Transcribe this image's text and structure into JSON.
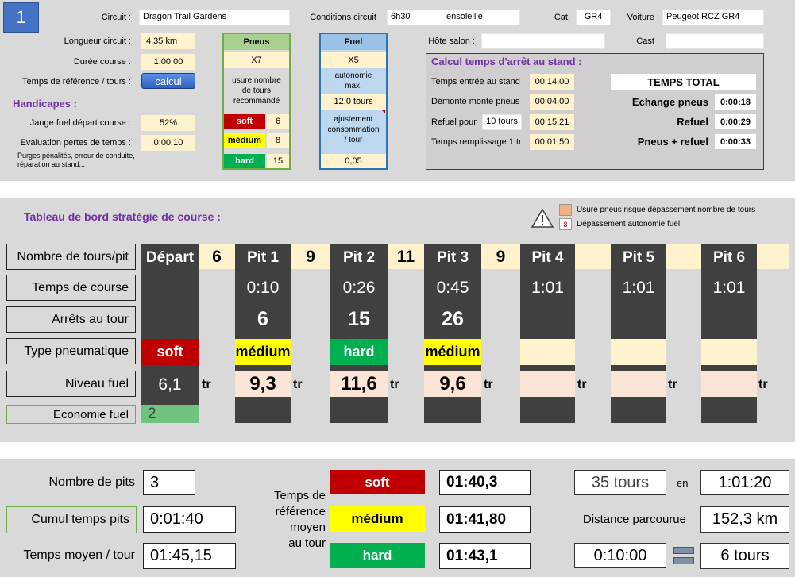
{
  "header": {
    "stage_number": "1",
    "circuit_label": "Circuit :",
    "circuit_value": "Dragon Trail Gardens",
    "conditions_label": "Conditions circuit :",
    "conditions_time": "6h30",
    "conditions_weather": "ensoleillé",
    "cat_label": "Cat.",
    "cat_value": "GR4",
    "car_label": "Voiture :",
    "car_value": "Peugeot RCZ GR4",
    "host_label": "Hôte salon :",
    "host_value": "",
    "cast_label": "Cast :",
    "cast_value": ""
  },
  "params": {
    "length_label": "Longueur circuit :",
    "length_value": "4,35 km",
    "duration_label": "Durée course :",
    "duration_value": "1:00:00",
    "ref_time_label": "Temps de référence / tours :",
    "calc_button": "calcul",
    "handicap_title": "Handicapes :",
    "fuel_start_label": "Jauge fuel départ course :",
    "fuel_start_value": "52%",
    "loss_label": "Evaluation pertes de temps :",
    "loss_value": "0:00:10",
    "loss_note_1": "Purges pénalités, erreur de conduite,",
    "loss_note_2": "réparation au stand..."
  },
  "tyres_panel": {
    "title": "Pneus",
    "multiplier": "X7",
    "usage_1": "usure nombre",
    "usage_2": "de tours",
    "usage_3": "recommandé",
    "soft_label": "soft",
    "soft_value": "6",
    "medium_label": "médium",
    "medium_value": "8",
    "hard_label": "hard",
    "hard_value": "15"
  },
  "fuel_panel": {
    "title": "Fuel",
    "multiplier": "X5",
    "autonomy_1": "autonomie",
    "autonomy_2": "max.",
    "autonomy_value": "12,0 tours",
    "adjust_1": "ajustement",
    "adjust_2": "consommation",
    "adjust_3": "/ tour",
    "adjust_value": "0,05"
  },
  "pit_stop": {
    "title": "Calcul temps d'arrêt au stand :",
    "entry_label": "Temps entrée au stand",
    "entry_value": "00:14,00",
    "tyre_change_label": "Démonte monte pneus",
    "tyre_change_value": "00:04,00",
    "refuel_label": "Refuel pour",
    "refuel_laps": "10 tours",
    "refuel_value": "00:15,21",
    "fill_label": "Temps remplissage 1 tr",
    "fill_value": "00:01,50",
    "total_title": "TEMPS TOTAL",
    "exchange_label": "Echange pneus",
    "exchange_value": "0:00:18",
    "refuel_total_label": "Refuel",
    "refuel_total_value": "0:00:29",
    "both_label": "Pneus + refuel",
    "both_value": "0:00:33"
  },
  "dashboard": {
    "title": "Tableau de bord stratégie de course :",
    "legend_tyre_risk": "Usure pneus risque dépassement nombre de tours",
    "legend_fuel_marker": "8",
    "legend_fuel_exceed": "Dépassement autonomie fuel",
    "row_labels": [
      "Nombre de tours/pit",
      "Temps de course",
      "Arrêts au tour",
      "Type pneumatique",
      "Niveau fuel",
      "Economie fuel"
    ],
    "fuel_unit": "tr",
    "economy_value": "2",
    "columns": [
      {
        "name": "Départ",
        "laps": "6",
        "time": "",
        "stop": "",
        "tyre": "soft",
        "tyre_color": "#c00000",
        "tyre_text": "#ffffff",
        "fuel": "6,1"
      },
      {
        "name": "Pit 1",
        "laps": "9",
        "time": "0:10",
        "stop": "6",
        "tyre": "médium",
        "tyre_color": "#ffff00",
        "tyre_text": "#000000",
        "fuel": "9,3"
      },
      {
        "name": "Pit 2",
        "laps": "11",
        "time": "0:26",
        "stop": "15",
        "tyre": "hard",
        "tyre_color": "#00b050",
        "tyre_text": "#ffffff",
        "fuel": "11,6"
      },
      {
        "name": "Pit 3",
        "laps": "9",
        "time": "0:45",
        "stop": "26",
        "tyre": "médium",
        "tyre_color": "#ffff00",
        "tyre_text": "#000000",
        "fuel": "9,6"
      },
      {
        "name": "Pit 4",
        "laps": "",
        "time": "1:01",
        "stop": "",
        "tyre": "",
        "tyre_color": "#fff2cc",
        "tyre_text": "#000000",
        "fuel": ""
      },
      {
        "name": "Pit 5",
        "laps": "",
        "time": "1:01",
        "stop": "",
        "tyre": "",
        "tyre_color": "#fff2cc",
        "tyre_text": "#000000",
        "fuel": ""
      },
      {
        "name": "Pit 6",
        "laps": "",
        "time": "1:01",
        "stop": "",
        "tyre": "",
        "tyre_color": "#fff2cc",
        "tyre_text": "#000000",
        "fuel": ""
      }
    ]
  },
  "summary": {
    "pits_label": "Nombre de pits",
    "pits_value": "3",
    "cumul_label": "Cumul temps pits",
    "cumul_value": "0:01:40",
    "avg_label": "Temps moyen / tour",
    "avg_value": "01:45,15",
    "ref_label_1": "Temps de",
    "ref_label_2": "référence",
    "ref_label_3": "moyen",
    "ref_label_4": "au tour",
    "soft_label": "soft",
    "soft_time": "01:40,3",
    "medium_label": "médium",
    "medium_time": "01:41,80",
    "hard_label": "hard",
    "hard_time": "01:43,1",
    "total_laps": "35 tours",
    "in_label": "en",
    "total_time": "1:01:20",
    "distance_label": "Distance parcourue",
    "distance_value": "152,3 km",
    "lost_time": "0:10:00",
    "lost_laps": "6 tours"
  },
  "colors": {
    "soft": "#c00000",
    "medium": "#ffff00",
    "hard": "#00b050",
    "accent_purple": "#7030a0",
    "panel_gray": "#d9d9d9",
    "dark_column": "#404040",
    "cream": "#fff2cc",
    "peach": "#fce4d6"
  }
}
